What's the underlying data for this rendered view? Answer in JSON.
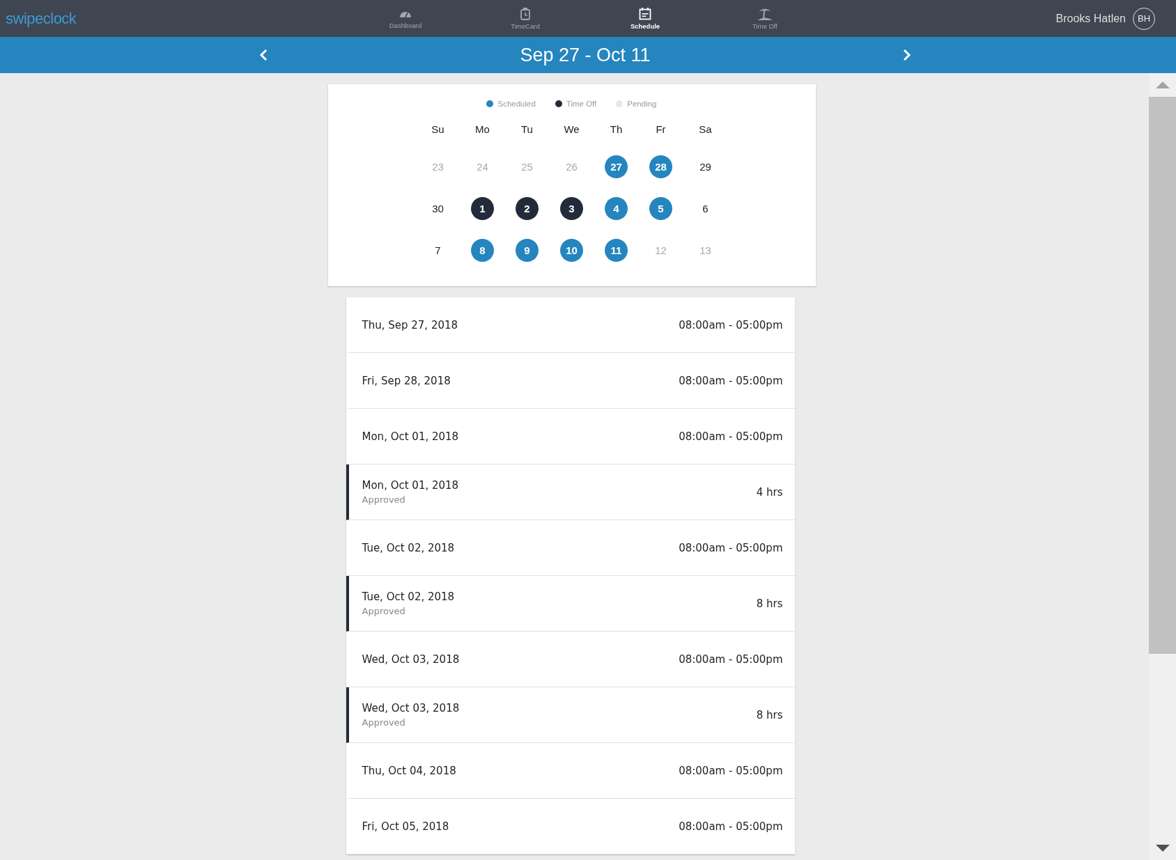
{
  "brand": "swipeclock",
  "nav": [
    {
      "label": "Dashboard",
      "selected": false
    },
    {
      "label": "TimeCard",
      "selected": false
    },
    {
      "label": "Schedule",
      "selected": true
    },
    {
      "label": "Time Off",
      "selected": false
    }
  ],
  "user": {
    "name": "Brooks Hatlen",
    "initials": "BH"
  },
  "period": {
    "title": "Sep 27 - Oct 11"
  },
  "legend": [
    {
      "label": "Scheduled",
      "color": "#2585bf"
    },
    {
      "label": "Time Off",
      "color": "#232b3a"
    },
    {
      "label": "Pending",
      "color": "#e8e8e8"
    }
  ],
  "weekdays": [
    "Su",
    "Mo",
    "Tu",
    "We",
    "Th",
    "Fr",
    "Sa"
  ],
  "days": [
    {
      "label": "23",
      "kind": "outside"
    },
    {
      "label": "24",
      "kind": "outside"
    },
    {
      "label": "25",
      "kind": "outside"
    },
    {
      "label": "26",
      "kind": "outside"
    },
    {
      "label": "27",
      "kind": "scheduled"
    },
    {
      "label": "28",
      "kind": "scheduled"
    },
    {
      "label": "29",
      "kind": "plain"
    },
    {
      "label": "30",
      "kind": "plain"
    },
    {
      "label": "1",
      "kind": "timeoff"
    },
    {
      "label": "2",
      "kind": "timeoff"
    },
    {
      "label": "3",
      "kind": "timeoff"
    },
    {
      "label": "4",
      "kind": "scheduled"
    },
    {
      "label": "5",
      "kind": "scheduled"
    },
    {
      "label": "6",
      "kind": "plain"
    },
    {
      "label": "7",
      "kind": "plain"
    },
    {
      "label": "8",
      "kind": "scheduled"
    },
    {
      "label": "9",
      "kind": "scheduled"
    },
    {
      "label": "10",
      "kind": "scheduled"
    },
    {
      "label": "11",
      "kind": "scheduled"
    },
    {
      "label": "12",
      "kind": "outside"
    },
    {
      "label": "13",
      "kind": "outside"
    }
  ],
  "entries": [
    {
      "kind": "shift",
      "date": "Thu, Sep 27, 2018",
      "value": "08:00am - 05:00pm"
    },
    {
      "kind": "shift",
      "date": "Fri, Sep 28, 2018",
      "value": "08:00am - 05:00pm"
    },
    {
      "kind": "shift",
      "date": "Mon, Oct 01, 2018",
      "value": "08:00am - 05:00pm"
    },
    {
      "kind": "timeoff",
      "date": "Mon, Oct 01, 2018",
      "status": "Approved",
      "value": "4 hrs"
    },
    {
      "kind": "shift",
      "date": "Tue, Oct 02, 2018",
      "value": "08:00am - 05:00pm"
    },
    {
      "kind": "timeoff",
      "date": "Tue, Oct 02, 2018",
      "status": "Approved",
      "value": "8 hrs"
    },
    {
      "kind": "shift",
      "date": "Wed, Oct 03, 2018",
      "value": "08:00am - 05:00pm"
    },
    {
      "kind": "timeoff",
      "date": "Wed, Oct 03, 2018",
      "status": "Approved",
      "value": "8 hrs"
    },
    {
      "kind": "shift",
      "date": "Thu, Oct 04, 2018",
      "value": "08:00am - 05:00pm"
    },
    {
      "kind": "shift",
      "date": "Fri, Oct 05, 2018",
      "value": "08:00am - 05:00pm"
    }
  ]
}
